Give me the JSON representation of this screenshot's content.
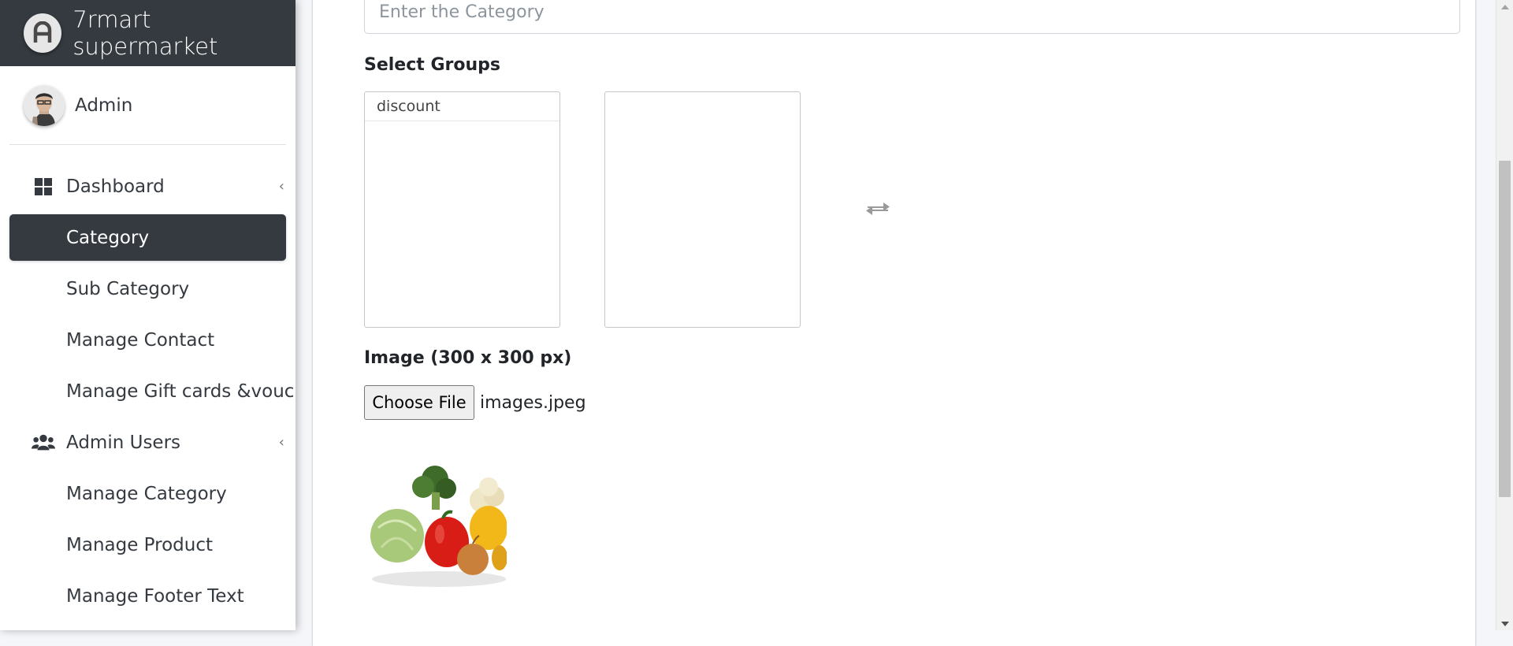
{
  "brand": {
    "title": "7rmart supermarket"
  },
  "user": {
    "name": "Admin"
  },
  "sidebar": {
    "items": [
      {
        "label": "Dashboard"
      },
      {
        "label": "Category"
      },
      {
        "label": "Sub Category"
      },
      {
        "label": "Manage Contact"
      },
      {
        "label": "Manage Gift cards &voucher"
      },
      {
        "label": "Admin Users"
      },
      {
        "label": "Manage Category"
      },
      {
        "label": "Manage Product"
      },
      {
        "label": "Manage Footer Text"
      }
    ]
  },
  "form": {
    "category_placeholder": "Enter the Category",
    "groups_label": "Select Groups",
    "groups_available": [
      "discount"
    ],
    "image_label": "Image (300 x 300 px)",
    "file_button": "Choose File",
    "file_name": "images.jpeg"
  },
  "colors": {
    "sidebar_dark": "#343a40",
    "page_bg": "#f4f6f9"
  }
}
